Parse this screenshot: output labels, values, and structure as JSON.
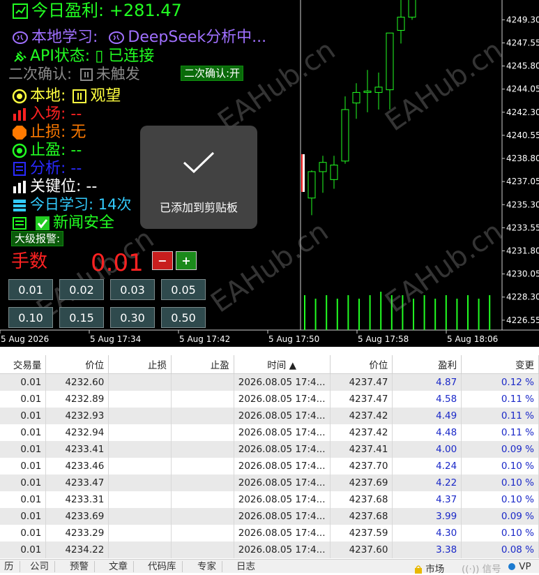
{
  "panel": {
    "profit_label": "今日盈利: +281.47",
    "local_learning": "本地学习:",
    "deepseek": "DeepSeek分析中...",
    "api_status": "API状态: ▯ 已连接",
    "second_confirm": "二次确认:",
    "second_confirm_state": "未触发",
    "second_confirm_btn": "二次确认:开",
    "local_label": "本地:",
    "local_value": "观望",
    "entry": "入场: --",
    "stop_loss": "止损: 无",
    "take_profit": "止盈: --",
    "analysis": "分析: --",
    "key_level": "关键位: --",
    "today_learning": "今日学习: 14次",
    "news": "新闻安全",
    "big_alert": "大级报警:",
    "lots_label": "手数",
    "lots_value": "0.01",
    "minus": "−",
    "plus": "+",
    "lot_buttons": [
      "0.01",
      "0.02",
      "0.03",
      "0.05",
      "0.10",
      "0.15",
      "0.30",
      "0.50"
    ]
  },
  "toast": {
    "message": "已添加到剪贴板"
  },
  "watermark": "EAHub.cn",
  "colors": {
    "green": "#22ff22",
    "red": "#ff2222",
    "orange": "#ff7a00",
    "yellow": "#ffff40",
    "purple": "#a070ff",
    "blue": "#2a2aff",
    "cyan": "#33ccff",
    "table_blue": "#1a28c8"
  },
  "chart_data": {
    "type": "candlestick",
    "y_ticks": [
      "4249.30",
      "4247.55",
      "4245.80",
      "4244.05",
      "4242.30",
      "4240.55",
      "4238.80",
      "4237.05",
      "4235.30",
      "4233.55",
      "4231.80",
      "4230.05",
      "4228.30",
      "4226.55"
    ],
    "x_ticks": [
      "5 Aug 2026",
      "5 Aug 17:34",
      "5 Aug 17:42",
      "5 Aug 17:50",
      "5 Aug 17:58",
      "5 Aug 18:06"
    ],
    "ylim": [
      4225.8,
      4250.8
    ],
    "candles": [
      {
        "o": 4235.8,
        "h": 4237.9,
        "l": 4234.5,
        "c": 4237.8
      },
      {
        "o": 4237.8,
        "h": 4239.0,
        "l": 4236.2,
        "c": 4238.5
      },
      {
        "o": 4237.2,
        "h": 4239.0,
        "l": 4236.5,
        "c": 4238.3
      },
      {
        "o": 4238.6,
        "h": 4243.5,
        "l": 4238.4,
        "c": 4242.5
      },
      {
        "o": 4243.0,
        "h": 4244.5,
        "l": 4241.8,
        "c": 4243.8
      },
      {
        "o": 4243.8,
        "h": 4245.5,
        "l": 4242.3,
        "c": 4243.9
      },
      {
        "o": 4243.8,
        "h": 4245.3,
        "l": 4242.5,
        "c": 4244.2
      },
      {
        "o": 4244.0,
        "h": 4246.0,
        "l": 4242.5,
        "c": 4248.3
      },
      {
        "o": 4248.5,
        "h": 4251.0,
        "l": 4247.5,
        "c": 4249.5
      },
      {
        "o": 4249.5,
        "h": 4251.0,
        "l": 4249.3,
        "c": 4251.0
      }
    ],
    "volumes": [
      0.5,
      0.45,
      0.5,
      0.45,
      0.5,
      0.45,
      0.5,
      0.55,
      0.5,
      0.5,
      0.45,
      0.5,
      0.45,
      0.5,
      0.45,
      0.5,
      0.45,
      0.5
    ]
  },
  "table": {
    "headers": [
      "交易量",
      "价位",
      "止损",
      "止盈",
      "时间 ▲",
      "价位",
      "盈利",
      "变更"
    ],
    "rows": [
      [
        "0.01",
        "4232.60",
        "",
        "",
        "2026.08.05 17:4...",
        "4237.47",
        "4.87",
        "0.12 %"
      ],
      [
        "0.01",
        "4232.89",
        "",
        "",
        "2026.08.05 17:4...",
        "4237.47",
        "4.58",
        "0.11 %"
      ],
      [
        "0.01",
        "4232.93",
        "",
        "",
        "2026.08.05 17:4...",
        "4237.42",
        "4.49",
        "0.11 %"
      ],
      [
        "0.01",
        "4232.94",
        "",
        "",
        "2026.08.05 17:4...",
        "4237.42",
        "4.48",
        "0.11 %"
      ],
      [
        "0.01",
        "4233.41",
        "",
        "",
        "2026.08.05 17:4...",
        "4237.41",
        "4.00",
        "0.09 %"
      ],
      [
        "0.01",
        "4233.46",
        "",
        "",
        "2026.08.05 17:4...",
        "4237.70",
        "4.24",
        "0.10 %"
      ],
      [
        "0.01",
        "4233.47",
        "",
        "",
        "2026.08.05 17:4...",
        "4237.69",
        "4.22",
        "0.10 %"
      ],
      [
        "0.01",
        "4233.31",
        "",
        "",
        "2026.08.05 17:4...",
        "4237.68",
        "4.37",
        "0.10 %"
      ],
      [
        "0.01",
        "4233.69",
        "",
        "",
        "2026.08.05 17:4...",
        "4237.68",
        "3.99",
        "0.09 %"
      ],
      [
        "0.01",
        "4233.29",
        "",
        "",
        "2026.08.05 17:4...",
        "4237.59",
        "4.30",
        "0.10 %"
      ],
      [
        "0.01",
        "4234.22",
        "",
        "",
        "2026.08.05 17:4...",
        "4237.60",
        "3.38",
        "0.08 %"
      ]
    ]
  },
  "statusbar": {
    "tabs": [
      "历",
      "公司",
      "预警",
      "文章",
      "代码库",
      "专家",
      "日志"
    ],
    "market": "市场",
    "signal": "信号",
    "vps": "VP"
  }
}
